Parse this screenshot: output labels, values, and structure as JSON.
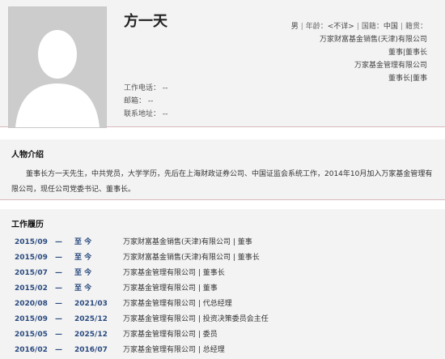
{
  "profile": {
    "name": "方一天",
    "gender": "男",
    "age_label": "年龄：",
    "age_value": "<不详>",
    "nationality_label": "国籍：",
    "nationality_value": "中国",
    "native_place_label": "籍贯：",
    "affiliations": [
      "万家财富基金销售(天津)有限公司",
      "董事|董事长",
      "万家基金管理有限公司",
      "董事长|董事"
    ],
    "contact": {
      "phone_label": "工作电话：",
      "phone_value": "--",
      "email_label": "邮箱：",
      "email_value": "--",
      "address_label": "联系地址：",
      "address_value": "--"
    }
  },
  "intro": {
    "title": "人物介绍",
    "text": "董事长方一天先生，中共党员，大学学历，先后在上海财政证券公司、中国证监会系统工作，2014年10月加入万家基金管理有限公司，现任公司党委书记、董事长。"
  },
  "career": {
    "title": "工作履历",
    "rows": [
      {
        "start": "2015/09",
        "dash": "—",
        "end": "至 今",
        "desc": "万家财富基金销售(天津)有限公司 | 董事"
      },
      {
        "start": "2015/09",
        "dash": "—",
        "end": "至 今",
        "desc": "万家财富基金销售(天津)有限公司 | 董事长"
      },
      {
        "start": "2015/07",
        "dash": "—",
        "end": "至 今",
        "desc": "万家基金管理有限公司 | 董事长"
      },
      {
        "start": "2015/02",
        "dash": "—",
        "end": "至 今",
        "desc": "万家基金管理有限公司 | 董事"
      },
      {
        "start": "2020/08",
        "dash": "—",
        "end": "2021/03",
        "desc": "万家基金管理有限公司 | 代总经理"
      },
      {
        "start": "2015/09",
        "dash": "—",
        "end": "2025/12",
        "desc": "万家基金管理有限公司 | 投资决策委员会主任"
      },
      {
        "start": "2015/05",
        "dash": "—",
        "end": "2025/12",
        "desc": "万家基金管理有限公司 | 委员"
      },
      {
        "start": "2016/02",
        "dash": "—",
        "end": "2016/07",
        "desc": "万家基金管理有限公司 | 总经理"
      }
    ]
  },
  "icons": {
    "photo": "person-placeholder-icon"
  }
}
